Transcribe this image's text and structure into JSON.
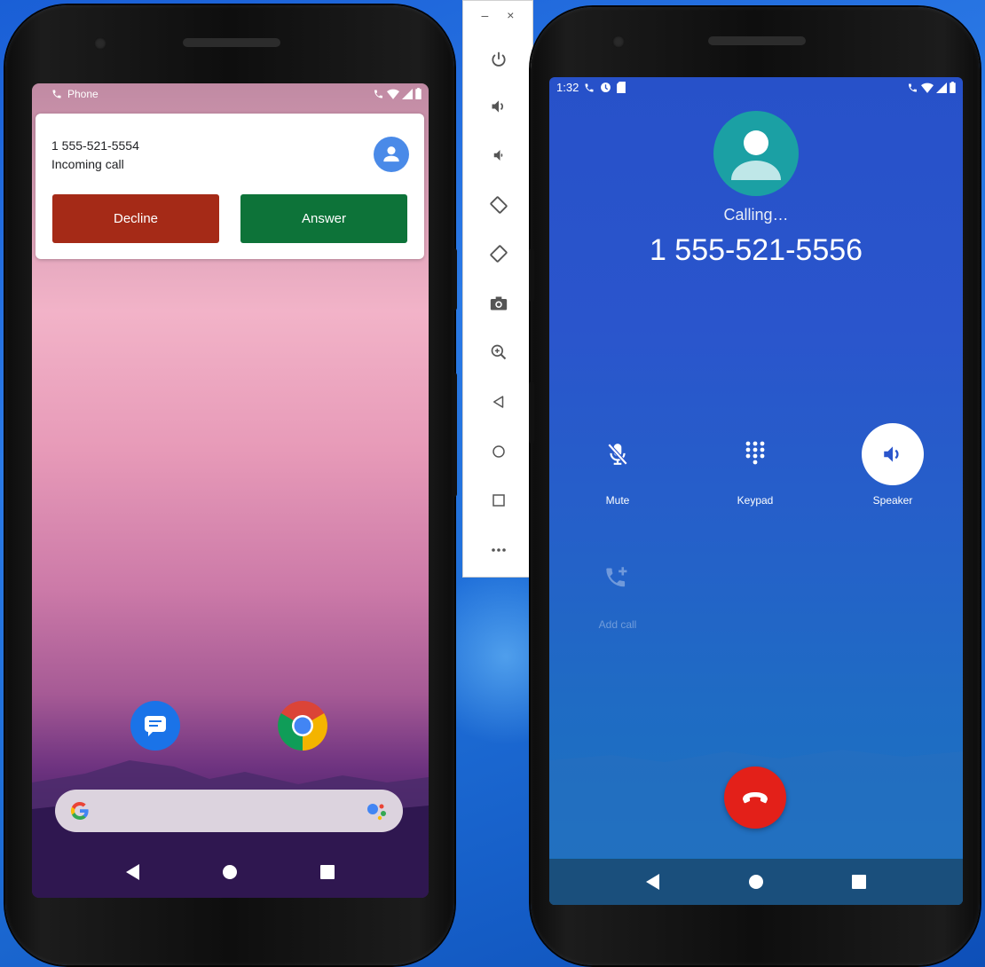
{
  "left_phone": {
    "status_bar": {
      "app_label": "Phone"
    },
    "notification": {
      "number": "1 555-521-5554",
      "subtitle": "Incoming call",
      "decline_label": "Decline",
      "answer_label": "Answer"
    },
    "home": {
      "apps": [
        {
          "name": "messages-app-icon",
          "color": "#1a73e8"
        },
        {
          "name": "chrome-app-icon",
          "color": "#ea4335"
        }
      ]
    },
    "nav": [
      "back-icon",
      "home-icon",
      "recents-icon"
    ]
  },
  "emulator_toolbar": {
    "window_controls": {
      "minimize": "–",
      "close": "×"
    },
    "buttons": [
      "power-icon",
      "volume-up-icon",
      "volume-down-icon",
      "rotate-left-icon",
      "rotate-right-icon",
      "screenshot-icon",
      "zoom-icon",
      "back-icon",
      "home-icon",
      "overview-icon",
      "more-icon"
    ]
  },
  "right_phone": {
    "status_bar": {
      "time": "1:32"
    },
    "call": {
      "status": "Calling…",
      "number": "1 555-521-5556"
    },
    "controls": [
      {
        "label": "Mute",
        "icon": "mic-off-icon",
        "enabled": true,
        "active": false
      },
      {
        "label": "Keypad",
        "icon": "dialpad-icon",
        "enabled": true,
        "active": false
      },
      {
        "label": "Speaker",
        "icon": "speaker-icon",
        "enabled": true,
        "active": true
      },
      {
        "label": "Add call",
        "icon": "add-call-icon",
        "enabled": false,
        "active": false
      }
    ],
    "colors": {
      "end_call": "#e32019",
      "avatar": "#1ba0a4"
    }
  }
}
